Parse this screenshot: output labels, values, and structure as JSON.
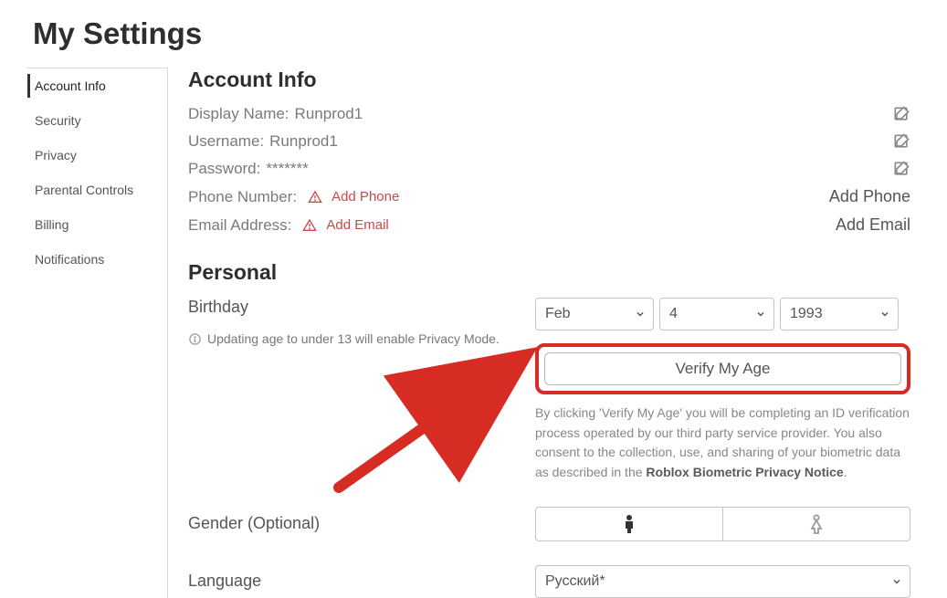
{
  "page_title": "My Settings",
  "sidebar": {
    "items": [
      {
        "label": "Account Info",
        "active": true
      },
      {
        "label": "Security",
        "active": false
      },
      {
        "label": "Privacy",
        "active": false
      },
      {
        "label": "Parental Controls",
        "active": false
      },
      {
        "label": "Billing",
        "active": false
      },
      {
        "label": "Notifications",
        "active": false
      }
    ]
  },
  "account_info": {
    "heading": "Account Info",
    "display_name_label": "Display Name:",
    "display_name_value": "Runprod1",
    "username_label": "Username:",
    "username_value": "Runprod1",
    "password_label": "Password:",
    "password_value": "*******",
    "phone_label": "Phone Number:",
    "phone_add_text": "Add Phone",
    "email_label": "Email Address:",
    "email_add_text": "Add Email",
    "right_add_phone": "Add Phone",
    "right_add_email": "Add Email"
  },
  "personal": {
    "heading": "Personal",
    "birthday_label": "Birthday",
    "birthday_note": "Updating age to under 13 will enable Privacy Mode.",
    "month": "Feb",
    "day": "4",
    "year": "1993",
    "verify_label": "Verify My Age",
    "disclaimer_text": "By clicking 'Verify My Age' you will be completing an ID verification process operated by our third party service provider. You also consent to the collection, use, and sharing of your biometric data as described in the ",
    "disclaimer_link": "Roblox Biometric Privacy Notice",
    "disclaimer_end": ".",
    "gender_label": "Gender (Optional)",
    "language_label": "Language",
    "language_value": "Русский*"
  }
}
